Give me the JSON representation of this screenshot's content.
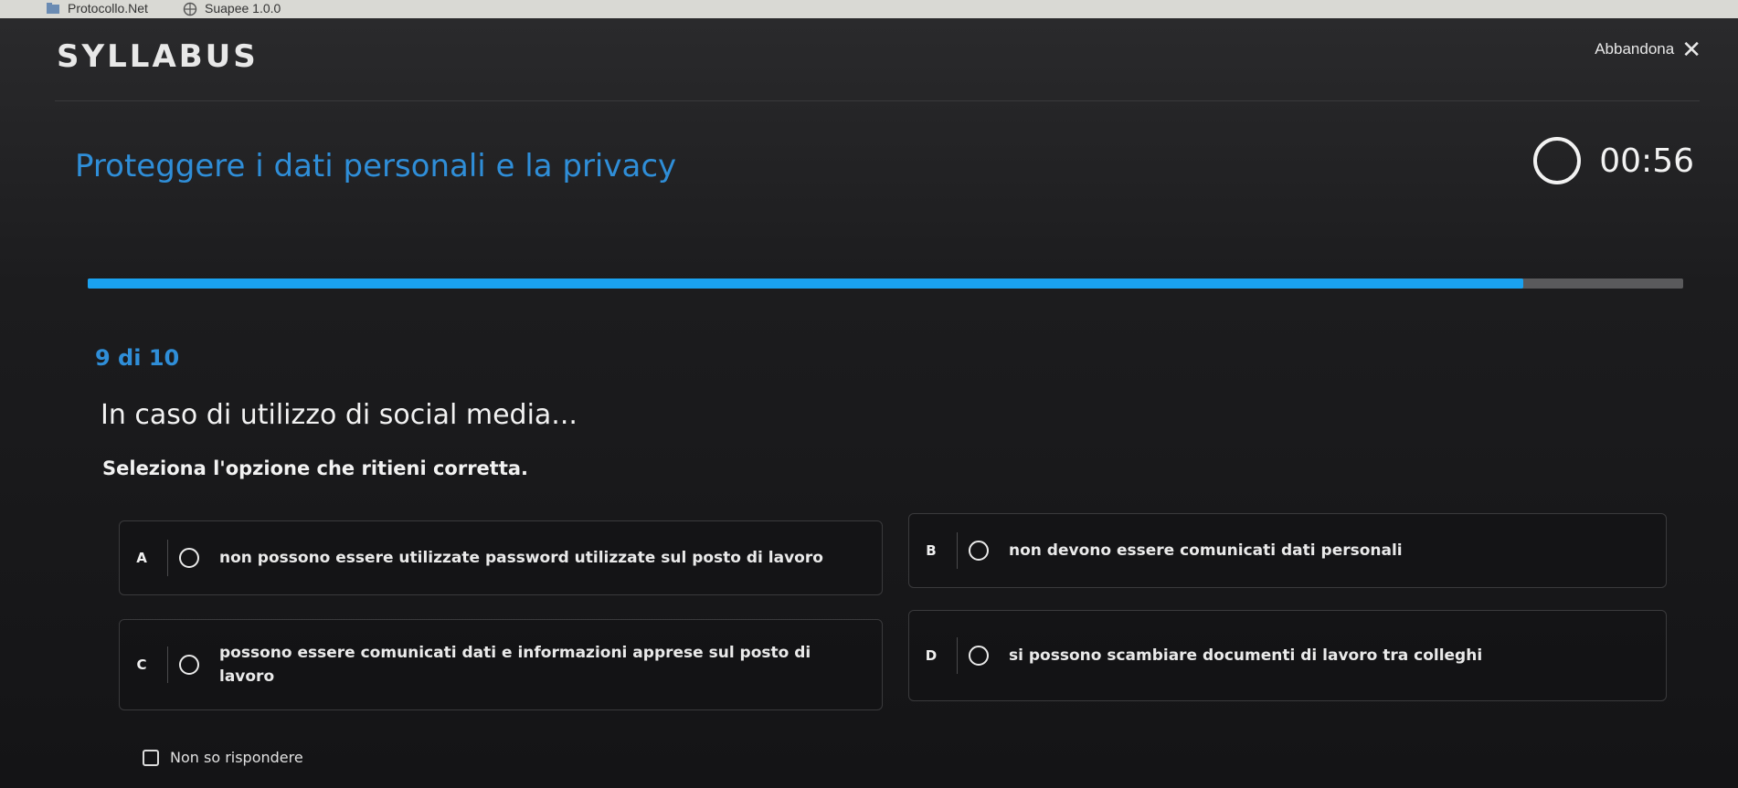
{
  "bookmarks": {
    "items": [
      {
        "label": "Protocollo.Net",
        "icon": "bookmark-folder-icon"
      },
      {
        "label": "Suapee 1.0.0",
        "icon": "globe-icon"
      }
    ]
  },
  "header": {
    "logo": "SYLLABUS",
    "abandon_label": "Abbandona",
    "abandon_icon": "close-icon"
  },
  "quiz": {
    "title": "Proteggere i dati personali e la privacy",
    "timer": "00:56",
    "progress_fraction": 0.9,
    "counter": "9 di 10",
    "question": "In caso di utilizzo di social media...",
    "instruction": "Seleziona l'opzione che ritieni corretta.",
    "options": [
      {
        "letter": "A",
        "text": "non possono essere utilizzate password utilizzate sul posto di lavoro"
      },
      {
        "letter": "B",
        "text": "non devono essere comunicati dati personali"
      },
      {
        "letter": "C",
        "text": "possono essere comunicati dati e informazioni apprese sul posto di lavoro"
      },
      {
        "letter": "D",
        "text": "si possono scambiare documenti di lavoro tra colleghi"
      }
    ],
    "no_answer_label": "Non so rispondere"
  },
  "colors": {
    "accent_blue": "#2f8ed8",
    "progress_blue": "#1aa2f0",
    "background": "#1b1b1d"
  }
}
